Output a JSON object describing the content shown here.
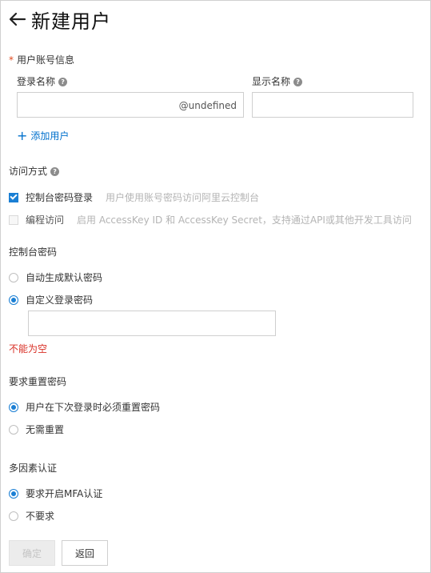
{
  "header": {
    "title": "新建用户"
  },
  "account": {
    "section_label": "用户账号信息",
    "required_mark": "*",
    "login_name_label": "登录名称",
    "login_name_value": "",
    "login_name_suffix": "@undefined",
    "display_name_label": "显示名称",
    "display_name_value": "",
    "add_user_label": "添加用户"
  },
  "access": {
    "label": "访问方式",
    "console": {
      "label": "控制台密码登录",
      "hint": "用户使用账号密码访问阿里云控制台",
      "checked": true
    },
    "api": {
      "label": "编程访问",
      "hint": "启用 AccessKey ID 和 AccessKey Secret，支持通过API或其他开发工具访问",
      "checked": false
    }
  },
  "password": {
    "label": "控制台密码",
    "auto_label": "自动生成默认密码",
    "custom_label": "自定义登录密码",
    "custom_value": "",
    "error": "不能为空"
  },
  "reset": {
    "label": "要求重置密码",
    "must_label": "用户在下次登录时必须重置密码",
    "none_label": "无需重置"
  },
  "mfa": {
    "label": "多因素认证",
    "require_label": "要求开启MFA认证",
    "no_label": "不要求"
  },
  "buttons": {
    "confirm": "确定",
    "back": "返回"
  }
}
